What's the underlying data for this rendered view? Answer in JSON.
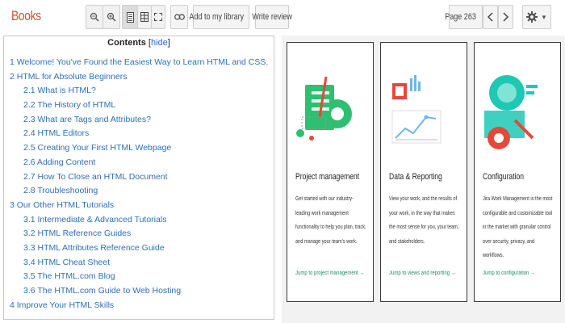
{
  "brand": "Books",
  "toolbar": {
    "zoom_out_icon": "zoom-out-icon",
    "zoom_in_icon": "zoom-in-icon",
    "add_to_library": "Add to my library",
    "write_review": "Write review",
    "page_label": "Page 263"
  },
  "contents": {
    "title": "Contents",
    "hide_bracket_open": "[",
    "hide_label": "hide",
    "hide_bracket_close": "]",
    "items": [
      {
        "level": 1,
        "text": "1 Welcome! You've Found the Easiest Way to Learn HTML and CSS."
      },
      {
        "level": 1,
        "text": "2 HTML for Absolute Beginners"
      },
      {
        "level": 2,
        "text": "2.1 What is HTML?"
      },
      {
        "level": 2,
        "text": "2.2 The History of HTML"
      },
      {
        "level": 2,
        "text": "2.3 What are Tags and Attributes?"
      },
      {
        "level": 2,
        "text": "2.4 HTML Editors"
      },
      {
        "level": 2,
        "text": "2.5 Creating Your First HTML Webpage"
      },
      {
        "level": 2,
        "text": "2.6 Adding Content"
      },
      {
        "level": 2,
        "text": "2.7 How To Close an HTML Document"
      },
      {
        "level": 2,
        "text": "2.8 Troubleshooting"
      },
      {
        "level": 1,
        "text": "3 Our Other HTML Tutorials"
      },
      {
        "level": 2,
        "text": "3.1 Intermediate & Advanced Tutorials"
      },
      {
        "level": 2,
        "text": "3.2 HTML Reference Guides"
      },
      {
        "level": 2,
        "text": "3.3 HTML Attributes Reference Guide"
      },
      {
        "level": 2,
        "text": "3.4 HTML Cheat Sheet"
      },
      {
        "level": 2,
        "text": "3.5 The HTML.com Blog"
      },
      {
        "level": 2,
        "text": "3.6 The HTML.com Guide to Web Hosting"
      },
      {
        "level": 1,
        "text": "4 Improve Your HTML Skills"
      }
    ]
  },
  "cards": [
    {
      "title": "Project management",
      "body": "Get started with our industry-leading work management functionality to help you plan, track, and manage your team's work.",
      "link": "Jump to project management →"
    },
    {
      "title": "Data & Reporting",
      "body": "View your work, and the results of your work, in the way that makes the most sense for you, your team, and stakeholders.",
      "link": "Jump to views and reporting →"
    },
    {
      "title": "Configuration",
      "body": "Jira Work Management is the most configurable and customizable tool in the market with granular control over security, privacy, and workflows.",
      "link": "Jump to configuration →"
    }
  ],
  "colors": {
    "brand": "#dd4b39",
    "toc_link": "#2e6fb6",
    "card_link": "#1f8a66",
    "illus_green": "#2fbf71",
    "illus_teal": "#1ec8b4",
    "illus_red": "#e5483b",
    "illus_blue": "#6fb7e6"
  }
}
